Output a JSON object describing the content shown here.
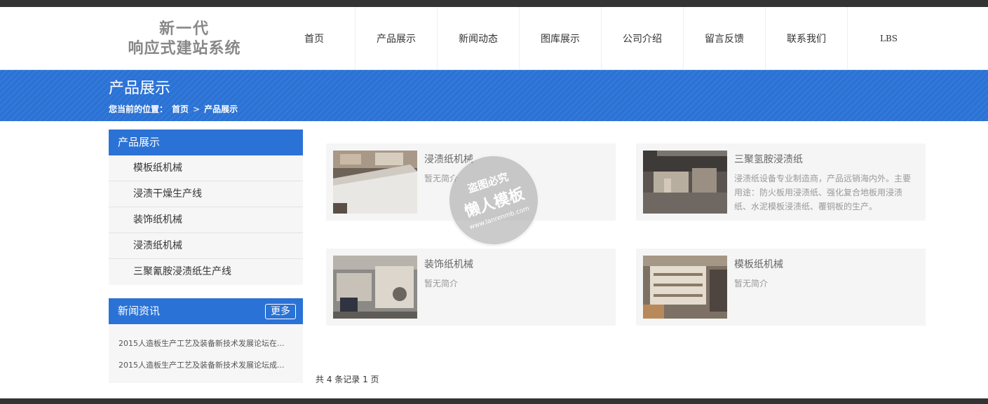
{
  "header": {
    "logo_line1": "新一代",
    "logo_line2": "响应式建站系统",
    "nav": [
      "首页",
      "产品展示",
      "新闻动态",
      "图库展示",
      "公司介绍",
      "留言反馈",
      "联系我们",
      "LBS"
    ]
  },
  "banner": {
    "title": "产品展示",
    "crumb_label": "您当前的位置：",
    "crumb_home": "首页",
    "crumb_sep": ">",
    "crumb_current": "产品展示"
  },
  "sidebar": {
    "title": "产品展示",
    "items": [
      "模板纸机械",
      "浸渍干燥生产线",
      "装饰纸机械",
      "浸渍纸机械",
      "三聚氰胺浸渍纸生产线"
    ]
  },
  "news": {
    "title": "新闻资讯",
    "more": "更多",
    "items": [
      "2015人造板生产工艺及装备新技术发展论坛在...",
      "2015人造板生产工艺及装备新技术发展论坛成..."
    ]
  },
  "products": [
    {
      "title": "浸渍纸机械",
      "desc": "暂无简介"
    },
    {
      "title": "三聚氢胺浸渍纸",
      "desc": "浸渍纸设备专业制造商，产品远销海内外。主要用途：防火板用浸渍纸、强化复合地板用浸渍纸、水泥模板浸渍纸、覆铜板的生产。"
    },
    {
      "title": "装饰纸机械",
      "desc": "暂无简介"
    },
    {
      "title": "模板纸机械",
      "desc": "暂无简介"
    }
  ],
  "pager": "共 4 条记录 1 页",
  "watermark": {
    "line1": "盗图必究",
    "line2": "懒人模板",
    "line3": "www.lanrenmb.com"
  },
  "colors": {
    "accent": "#2a72d5",
    "dark_bar": "#333333"
  }
}
